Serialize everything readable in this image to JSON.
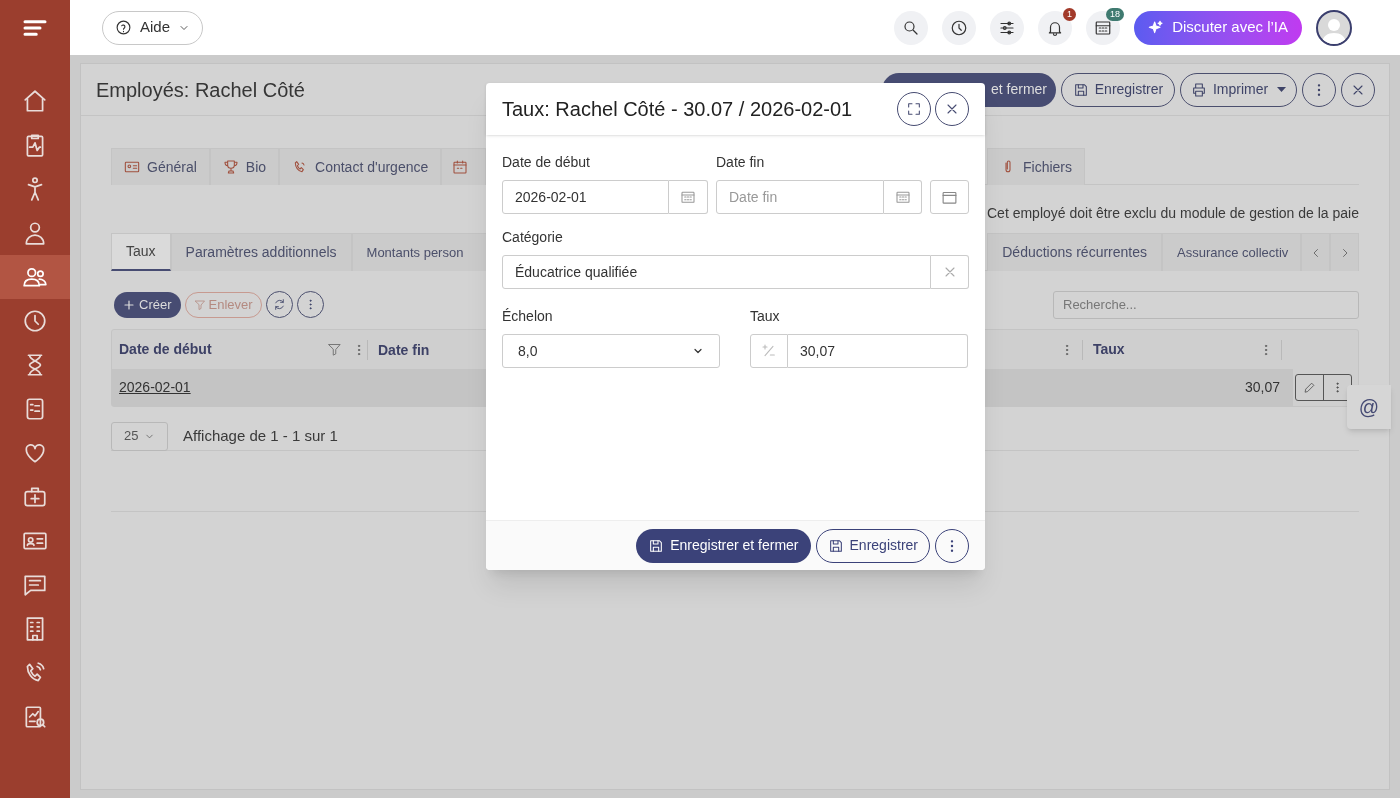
{
  "topbar": {
    "help_button": "Aide",
    "notifications_badge": "1",
    "calendar_badge": "18",
    "ai_button": "Discuter avec l’IA"
  },
  "sidebar": {
    "items": [
      {
        "selected": false
      },
      {
        "selected": false
      },
      {
        "selected": false
      },
      {
        "selected": false
      },
      {
        "selected": true
      },
      {
        "selected": false
      },
      {
        "selected": false
      },
      {
        "selected": false
      },
      {
        "selected": false
      },
      {
        "selected": false
      },
      {
        "selected": false
      },
      {
        "selected": false
      },
      {
        "selected": false
      },
      {
        "selected": false
      },
      {
        "selected": false
      }
    ]
  },
  "page": {
    "title": "Employés: Rachel Côté",
    "save_close_button": "et fermer",
    "save_button": "Enregistrer",
    "print_button": "Imprimer"
  },
  "tabs": [
    {
      "label": "Général"
    },
    {
      "label": "Bio"
    },
    {
      "label": "Contact d'urgence"
    },
    {
      "kind": "partial"
    },
    {
      "label": "Fichiers"
    }
  ],
  "notice": "Cet employé doit être exclu du module de gestion de la paie",
  "subtabs": [
    {
      "label": "Taux",
      "selected": true
    },
    {
      "label": "Paramètres additionnels",
      "selected": false
    },
    {
      "label": "Montants person",
      "selected": false
    },
    {
      "label": "Déductions récurrentes",
      "selected": false
    },
    {
      "label": "Assurance collectiv",
      "selected": false
    }
  ],
  "toolbar": {
    "create_button": "Créer",
    "remove_filter_button": "Enlever",
    "search": {
      "placeholder": "Recherche..."
    }
  },
  "table": {
    "columns": [
      "Date de début",
      "Date fin",
      "Taux"
    ],
    "rows": [
      {
        "start_date": "2026-02-01",
        "rate": "30,07"
      }
    ]
  },
  "pager": {
    "page_size": "25",
    "summary": "Affichage de 1 - 1 sur 1"
  },
  "mention_button": "@",
  "dialog": {
    "title": "Taux: Rachel Côté - 30.07 / 2026-02-01",
    "start_date": {
      "label": "Date de début",
      "value": "2026-02-01"
    },
    "end_date": {
      "label": "Date fin",
      "placeholder": "Date fin"
    },
    "category": {
      "label": "Catégorie",
      "value": "Éducatrice qualifiée"
    },
    "step": {
      "label": "Échelon",
      "value": "8,0"
    },
    "rate": {
      "label": "Taux",
      "value": "30,07"
    },
    "buttons": {
      "save_close": "Enregistrer et fermer",
      "save": "Enregistrer"
    }
  }
}
